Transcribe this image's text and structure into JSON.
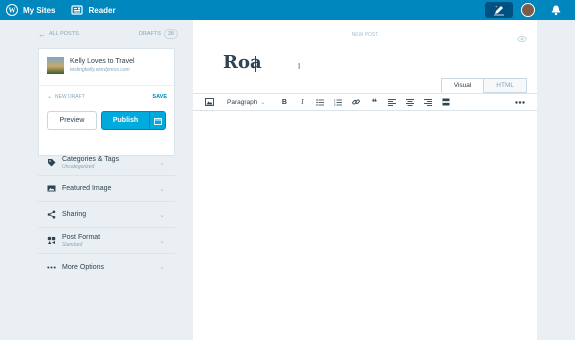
{
  "masterbar": {
    "my_sites_label": "My Sites",
    "reader_label": "Reader",
    "wp_icon": "wordpress-logo-icon",
    "reader_icon": "reader-icon",
    "write_icon": "write-post-icon",
    "notifications_icon": "bell-icon",
    "color": "#0087be"
  },
  "sidebar": {
    "all_posts_label": "All Posts",
    "drafts_label": "Drafts",
    "drafts_count": "38",
    "site": {
      "title": "Kelly Loves to Travel",
      "url": "testingkelly.wordpress.com"
    },
    "status_label": "New Draft",
    "save_label": "Save",
    "preview_label": "Preview",
    "publish_label": "Publish",
    "accordion": [
      {
        "title": "Categories & Tags",
        "subtitle": "Uncategorized",
        "icon": "tag-icon"
      },
      {
        "title": "Featured Image",
        "subtitle": "",
        "icon": "image-icon"
      },
      {
        "title": "Sharing",
        "subtitle": "",
        "icon": "share-icon"
      },
      {
        "title": "Post Format",
        "subtitle": "Standard",
        "icon": "post-format-icon"
      },
      {
        "title": "More Options",
        "subtitle": "",
        "icon": "ellipsis-icon"
      }
    ]
  },
  "editor": {
    "header_label": "New Post",
    "title_value": "Roa",
    "tabs": [
      "Visual",
      "HTML"
    ],
    "active_tab": "Visual",
    "format_select": "Paragraph",
    "toolbar_icons": [
      "add-media-icon",
      "bold-icon",
      "italic-icon",
      "bullet-list-icon",
      "numbered-list-icon",
      "link-icon",
      "blockquote-icon",
      "align-left-icon",
      "align-center-icon",
      "align-right-icon",
      "read-more-icon",
      "more-options-icon"
    ],
    "accent": "#00aadc"
  }
}
